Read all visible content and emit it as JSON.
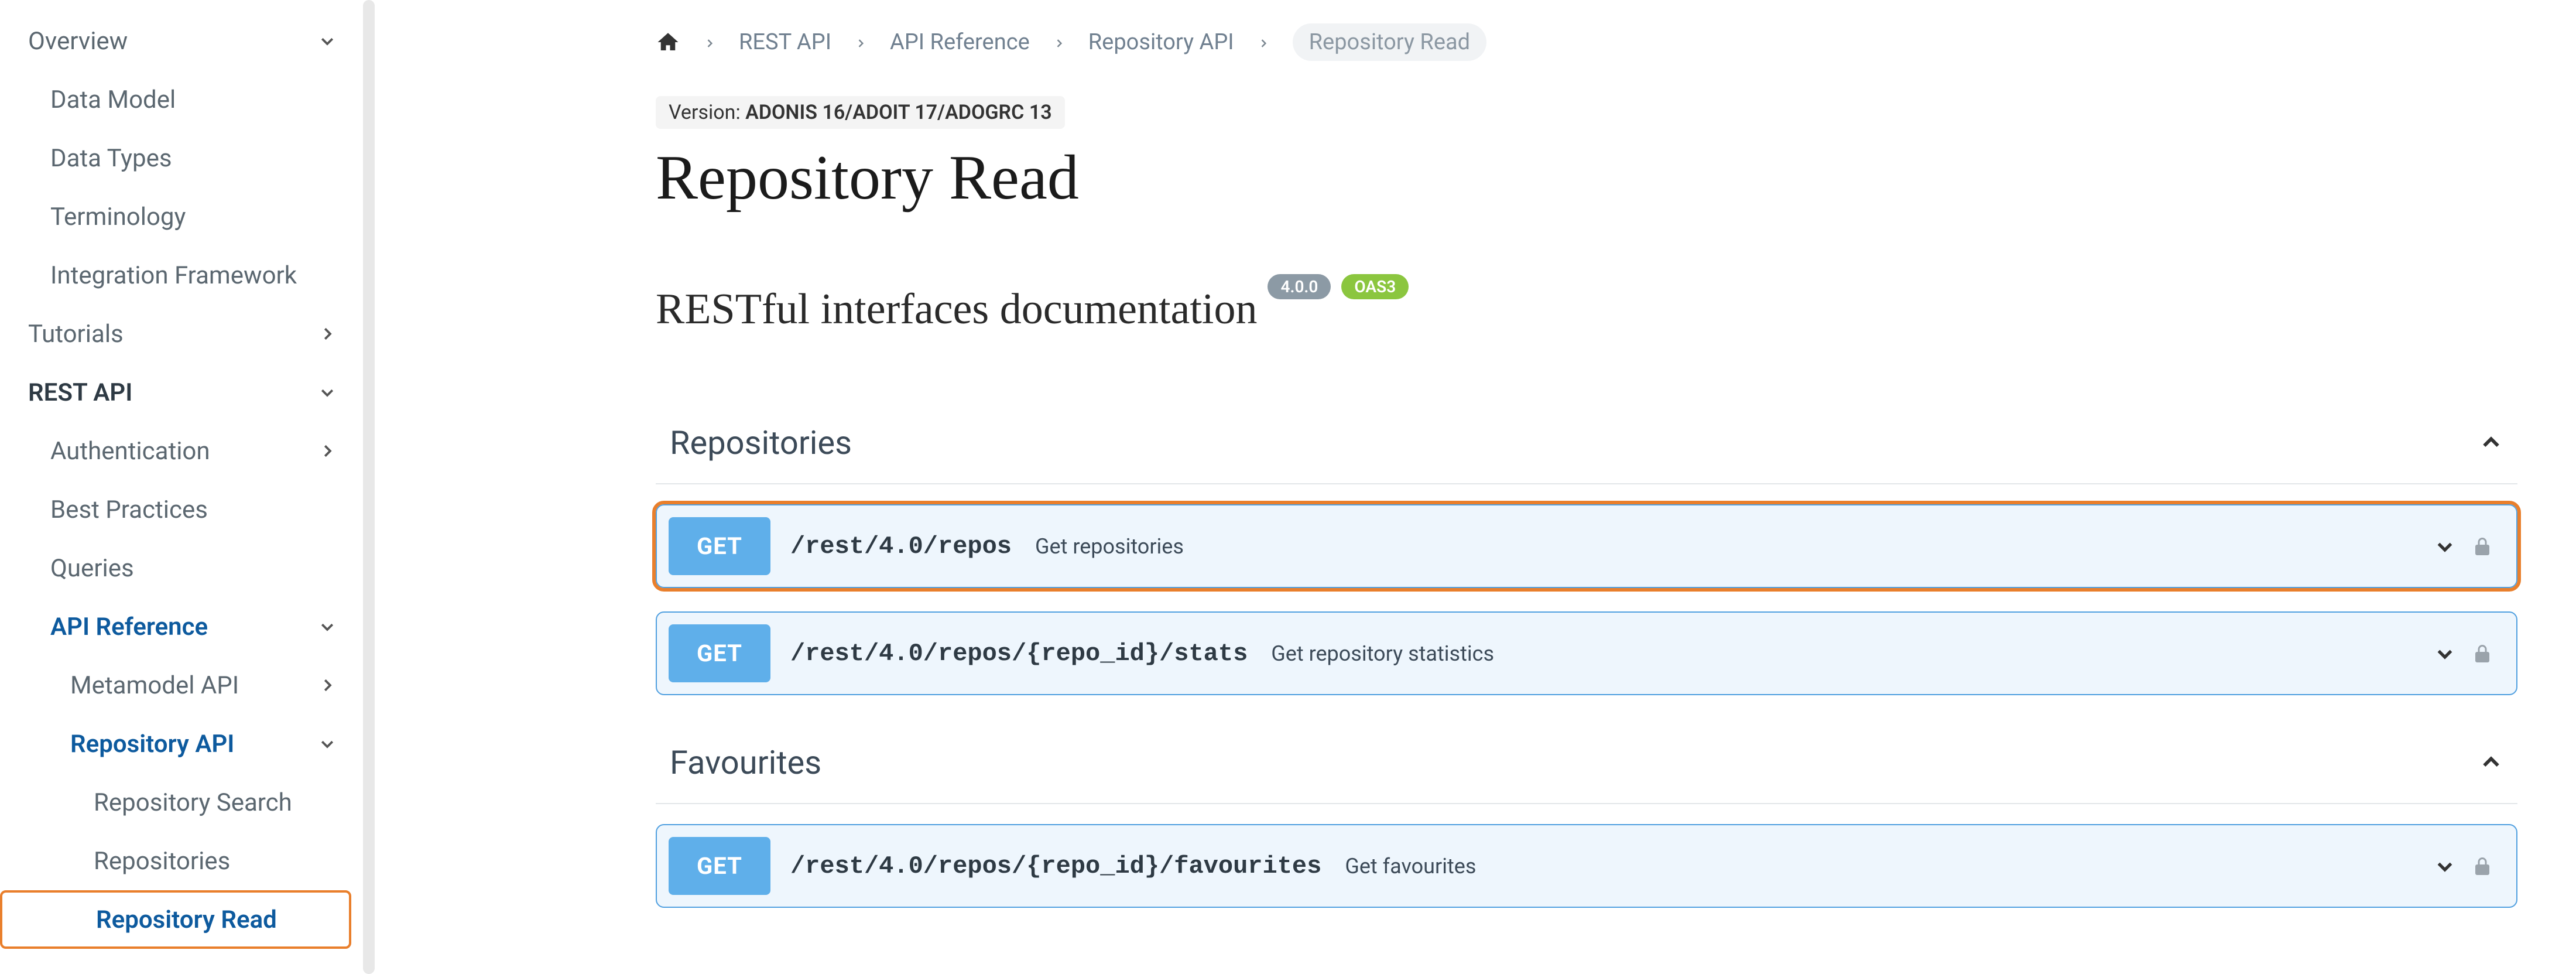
{
  "sidebar": {
    "overview": {
      "label": "Overview"
    },
    "data_model": {
      "label": "Data Model"
    },
    "data_types": {
      "label": "Data Types"
    },
    "terminology": {
      "label": "Terminology"
    },
    "int_fw": {
      "label": "Integration Framework"
    },
    "tutorials": {
      "label": "Tutorials"
    },
    "rest_api": {
      "label": "REST API"
    },
    "auth": {
      "label": "Authentication"
    },
    "best_prac": {
      "label": "Best Practices"
    },
    "queries": {
      "label": "Queries"
    },
    "api_ref": {
      "label": "API Reference"
    },
    "meta_api": {
      "label": "Metamodel API"
    },
    "repo_api": {
      "label": "Repository API"
    },
    "repo_search": {
      "label": "Repository Search"
    },
    "repositories": {
      "label": "Repositories"
    },
    "repo_read": {
      "label": "Repository Read"
    }
  },
  "breadcrumb": {
    "rest_api": "REST API",
    "api_ref": "API Reference",
    "repo_api": "Repository API",
    "current": "Repository Read"
  },
  "version": {
    "label": "Version: ",
    "value": "ADONIS 16/ADOIT 17/ADOGRC 13"
  },
  "page_title": "Repository Read",
  "subtitle": "RESTful interfaces documentation",
  "badges": {
    "version": "4.0.0",
    "spec": "OAS3"
  },
  "sections": {
    "repositories": {
      "title": "Repositories",
      "endpoints": [
        {
          "method": "GET",
          "path": "/rest/4.0/repos",
          "desc": "Get repositories"
        },
        {
          "method": "GET",
          "path": "/rest/4.0/repos/{repo_id}/stats",
          "desc": "Get repository statistics"
        }
      ]
    },
    "favourites": {
      "title": "Favourites",
      "endpoints": [
        {
          "method": "GET",
          "path": "/rest/4.0/repos/{repo_id}/favourites",
          "desc": "Get favourites"
        }
      ]
    }
  }
}
